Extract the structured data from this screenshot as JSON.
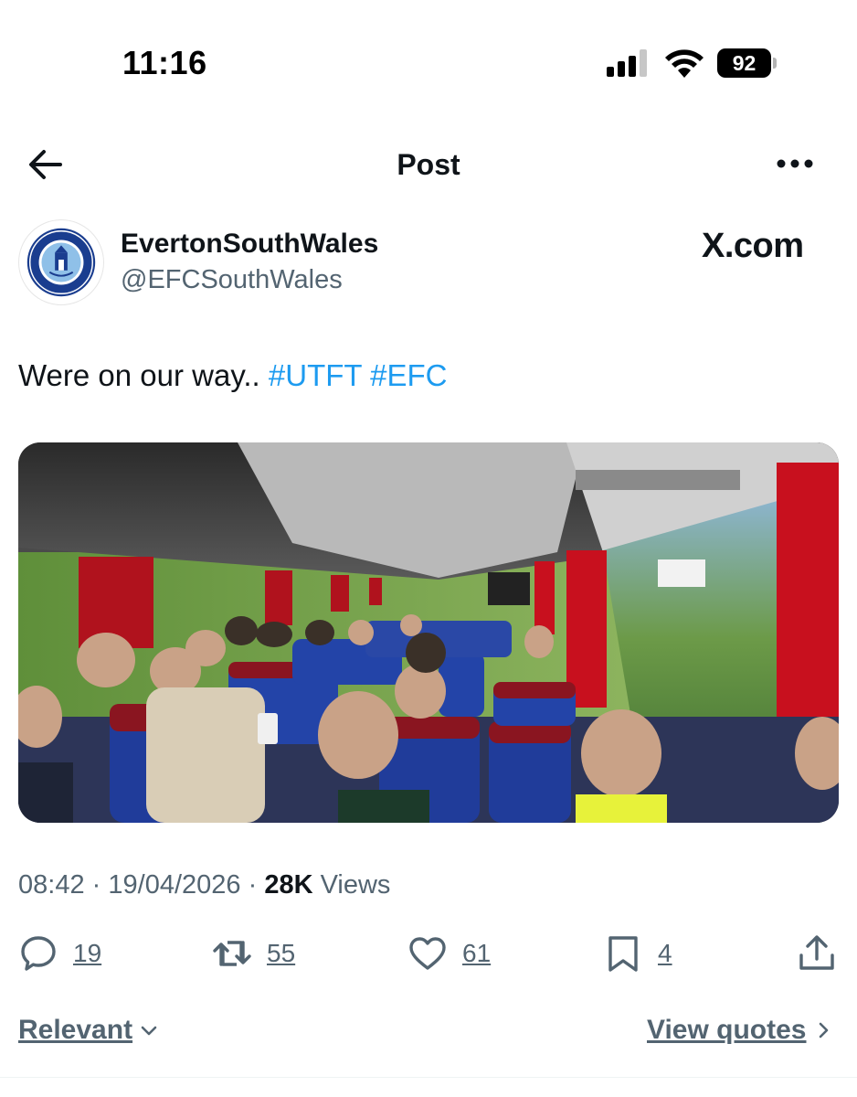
{
  "status_bar": {
    "time": "11:16",
    "battery": "92"
  },
  "nav": {
    "title": "Post"
  },
  "author": {
    "display_name": "EvertonSouthWales",
    "handle": "@EFCSouthWales",
    "badge_text": "X.com"
  },
  "tweet": {
    "text": "Were on our way..",
    "hashtags": [
      "#UTFT",
      "#EFC"
    ]
  },
  "media": {
    "alt": "Photo taken inside a coach full of passengers with blue patterned seats and red curtains"
  },
  "meta": {
    "time": "08:42",
    "date": "19/04/2026",
    "views_count": "28K",
    "views_label": "Views"
  },
  "actions": {
    "replies": "19",
    "reposts": "55",
    "likes": "61",
    "bookmarks": "4"
  },
  "footer": {
    "sort_label": "Relevant",
    "quotes_label": "View quotes"
  },
  "colors": {
    "accent": "#1d9bf0",
    "secondary_text": "#536471",
    "primary_text": "#0f1419"
  }
}
